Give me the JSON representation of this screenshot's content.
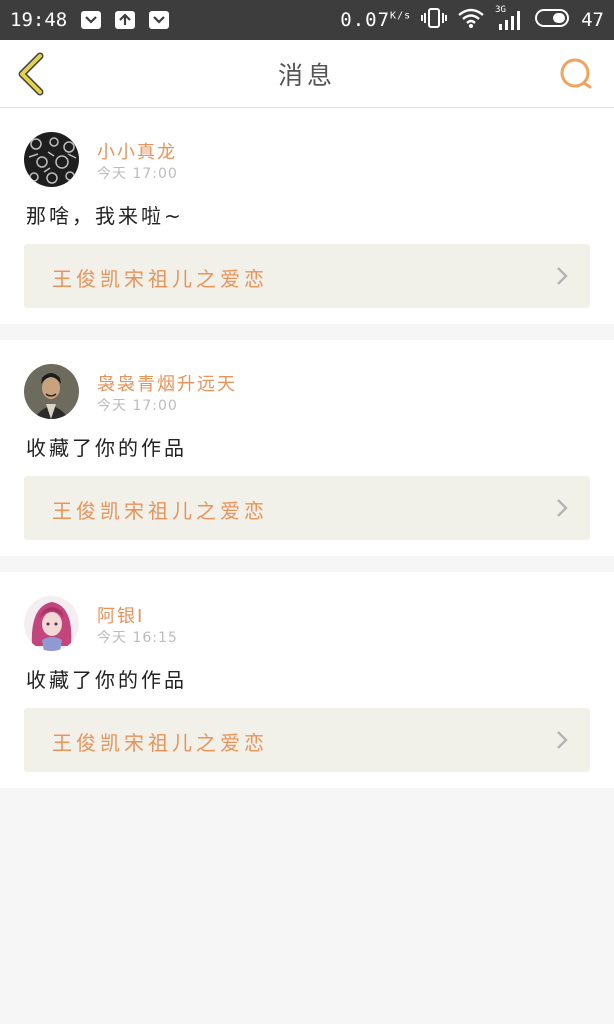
{
  "status_bar": {
    "time": "19:48",
    "speed_value": "0.07",
    "speed_unit": "K/s",
    "network": "3G",
    "battery": "47"
  },
  "header": {
    "title": "消息"
  },
  "messages": [
    {
      "username": "小小真龙",
      "time": "今天 17:00",
      "text": "那啥，我来啦~",
      "work_title": "王俊凯宋祖儿之爱恋"
    },
    {
      "username": "袅袅青烟升远天",
      "time": "今天 17:00",
      "text": "收藏了你的作品",
      "work_title": "王俊凯宋祖儿之爱恋"
    },
    {
      "username": "阿银I",
      "time": "今天 16:15",
      "text": "收藏了你的作品",
      "work_title": "王俊凯宋祖儿之爱恋"
    }
  ],
  "colors": {
    "accent": "#e8935a",
    "back_arrow": "#e3d24a",
    "card_link_bg": "#f1f1ea"
  }
}
